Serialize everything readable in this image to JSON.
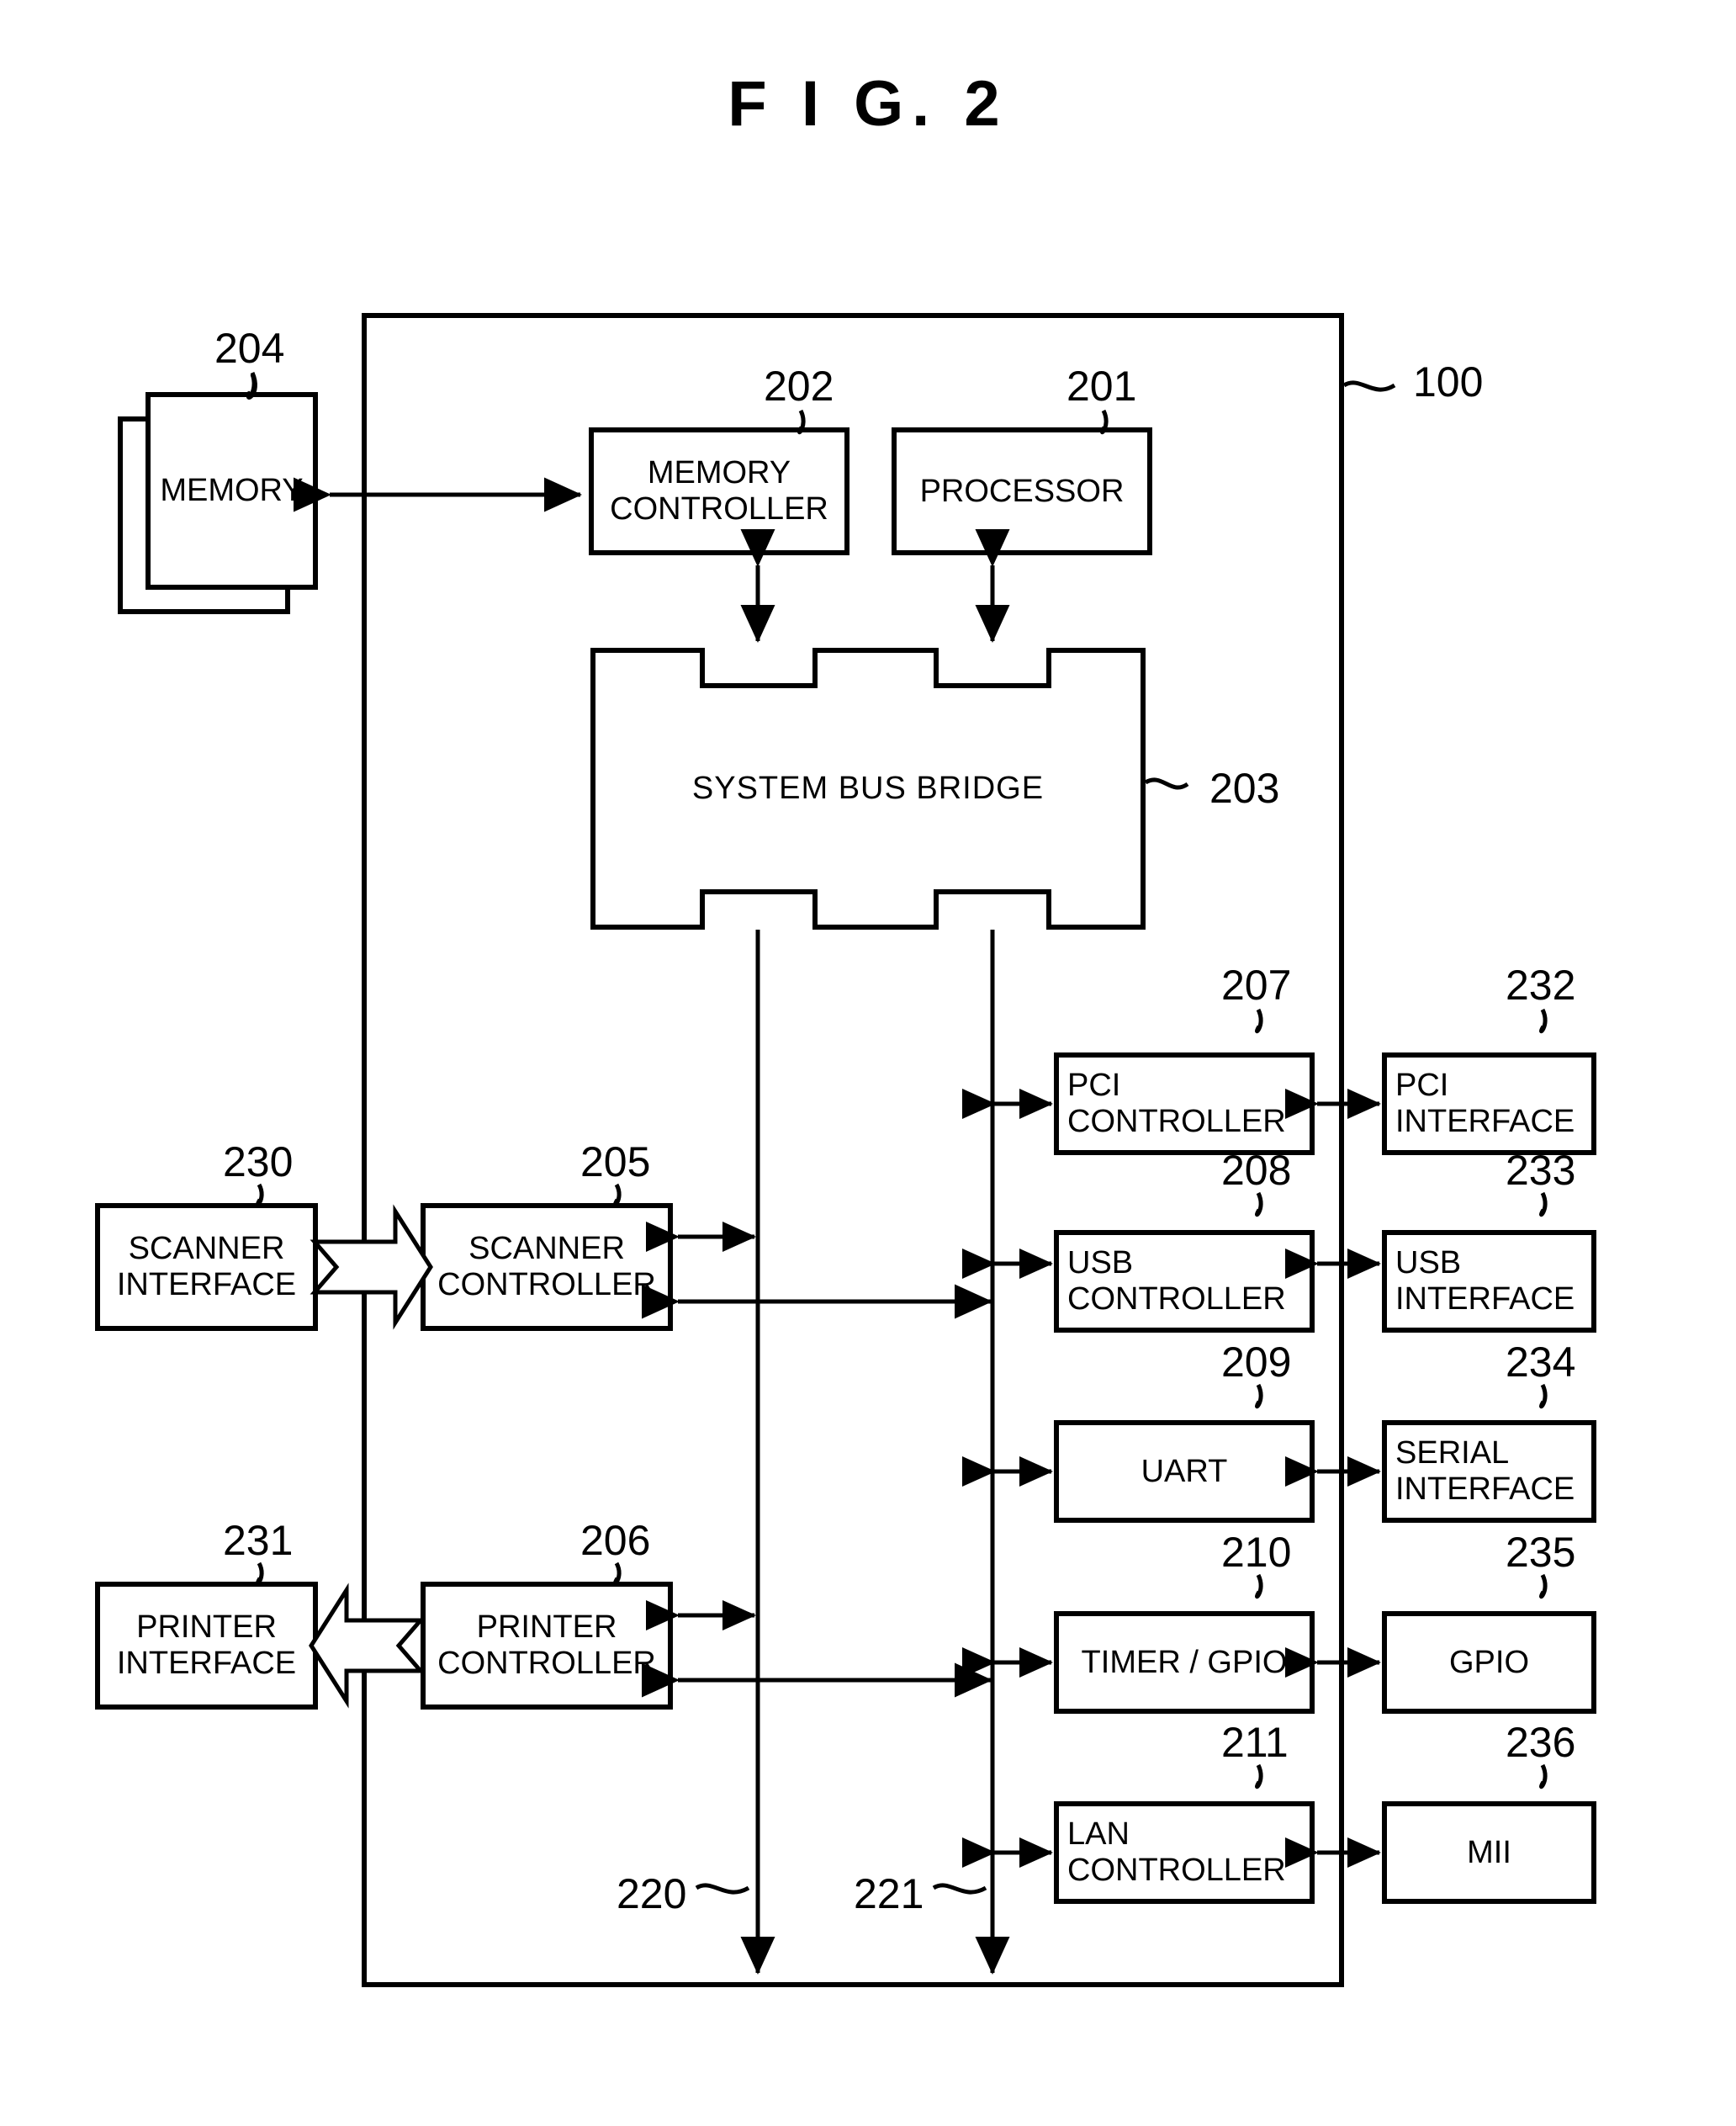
{
  "figure": {
    "title": "F I G.  2",
    "system_ref": "100"
  },
  "blocks": [
    {
      "id": "memory",
      "label_lines": [
        "MEMORY"
      ],
      "ref": "204"
    },
    {
      "id": "memory-controller",
      "label_lines": [
        "MEMORY",
        "CONTROLLER"
      ],
      "ref": "202"
    },
    {
      "id": "processor",
      "label_lines": [
        "PROCESSOR"
      ],
      "ref": "201"
    },
    {
      "id": "system-bus-bridge",
      "label_lines": [
        "SYSTEM  BUS  BRIDGE"
      ],
      "ref": "203"
    },
    {
      "id": "pci-controller",
      "label_lines": [
        "PCI",
        "CONTROLLER"
      ],
      "ref": "207"
    },
    {
      "id": "pci-interface",
      "label_lines": [
        "PCI",
        "INTERFACE"
      ],
      "ref": "232"
    },
    {
      "id": "usb-controller",
      "label_lines": [
        "USB",
        "CONTROLLER"
      ],
      "ref": "208"
    },
    {
      "id": "usb-interface",
      "label_lines": [
        "USB",
        "INTERFACE"
      ],
      "ref": "233"
    },
    {
      "id": "uart",
      "label_lines": [
        "UART"
      ],
      "ref": "209"
    },
    {
      "id": "serial-interface",
      "label_lines": [
        "SERIAL",
        "INTERFACE"
      ],
      "ref": "234"
    },
    {
      "id": "timer-gpio",
      "label_lines": [
        "TIMER / GPIO"
      ],
      "ref": "210"
    },
    {
      "id": "gpio",
      "label_lines": [
        "GPIO"
      ],
      "ref": "235"
    },
    {
      "id": "lan-controller",
      "label_lines": [
        "LAN",
        "CONTROLLER"
      ],
      "ref": "211"
    },
    {
      "id": "mii",
      "label_lines": [
        "MII"
      ],
      "ref": "236"
    },
    {
      "id": "scanner-interface",
      "label_lines": [
        "SCANNER",
        "INTERFACE"
      ],
      "ref": "230"
    },
    {
      "id": "scanner-controller",
      "label_lines": [
        "SCANNER",
        "CONTROLLER"
      ],
      "ref": "205"
    },
    {
      "id": "printer-interface",
      "label_lines": [
        "PRINTER",
        "INTERFACE"
      ],
      "ref": "231"
    },
    {
      "id": "printer-controller",
      "label_lines": [
        "PRINTER",
        "CONTROLLER"
      ],
      "ref": "206"
    }
  ],
  "buses": [
    {
      "id": "bus-220",
      "ref": "220"
    },
    {
      "id": "bus-221",
      "ref": "221"
    }
  ],
  "text": {
    "memory": "MEMORY",
    "memory_controller_l1": "MEMORY",
    "memory_controller_l2": "CONTROLLER",
    "processor": "PROCESSOR",
    "system_bus_bridge": "SYSTEM  BUS  BRIDGE",
    "pci_controller_l1": "PCI",
    "pci_controller_l2": "CONTROLLER",
    "pci_interface_l1": "PCI",
    "pci_interface_l2": "INTERFACE",
    "usb_controller_l1": "USB",
    "usb_controller_l2": "CONTROLLER",
    "usb_interface_l1": "USB",
    "usb_interface_l2": "INTERFACE",
    "uart": "UART",
    "serial_interface_l1": "SERIAL",
    "serial_interface_l2": "INTERFACE",
    "timer_gpio": "TIMER / GPIO",
    "gpio": "GPIO",
    "lan_controller_l1": "LAN",
    "lan_controller_l2": "CONTROLLER",
    "mii": "MII",
    "scanner_interface_l1": "SCANNER",
    "scanner_interface_l2": "INTERFACE",
    "scanner_controller_l1": "SCANNER",
    "scanner_controller_l2": "CONTROLLER",
    "printer_interface_l1": "PRINTER",
    "printer_interface_l2": "INTERFACE",
    "printer_controller_l1": "PRINTER",
    "printer_controller_l2": "CONTROLLER"
  },
  "refs": {
    "r100": "100",
    "r201": "201",
    "r202": "202",
    "r203": "203",
    "r204": "204",
    "r205": "205",
    "r206": "206",
    "r207": "207",
    "r208": "208",
    "r209": "209",
    "r210": "210",
    "r211": "211",
    "r220": "220",
    "r221": "221",
    "r230": "230",
    "r231": "231",
    "r232": "232",
    "r233": "233",
    "r234": "234",
    "r235": "235",
    "r236": "236"
  },
  "colors": {
    "ink": "#000000",
    "paper": "#ffffff"
  }
}
